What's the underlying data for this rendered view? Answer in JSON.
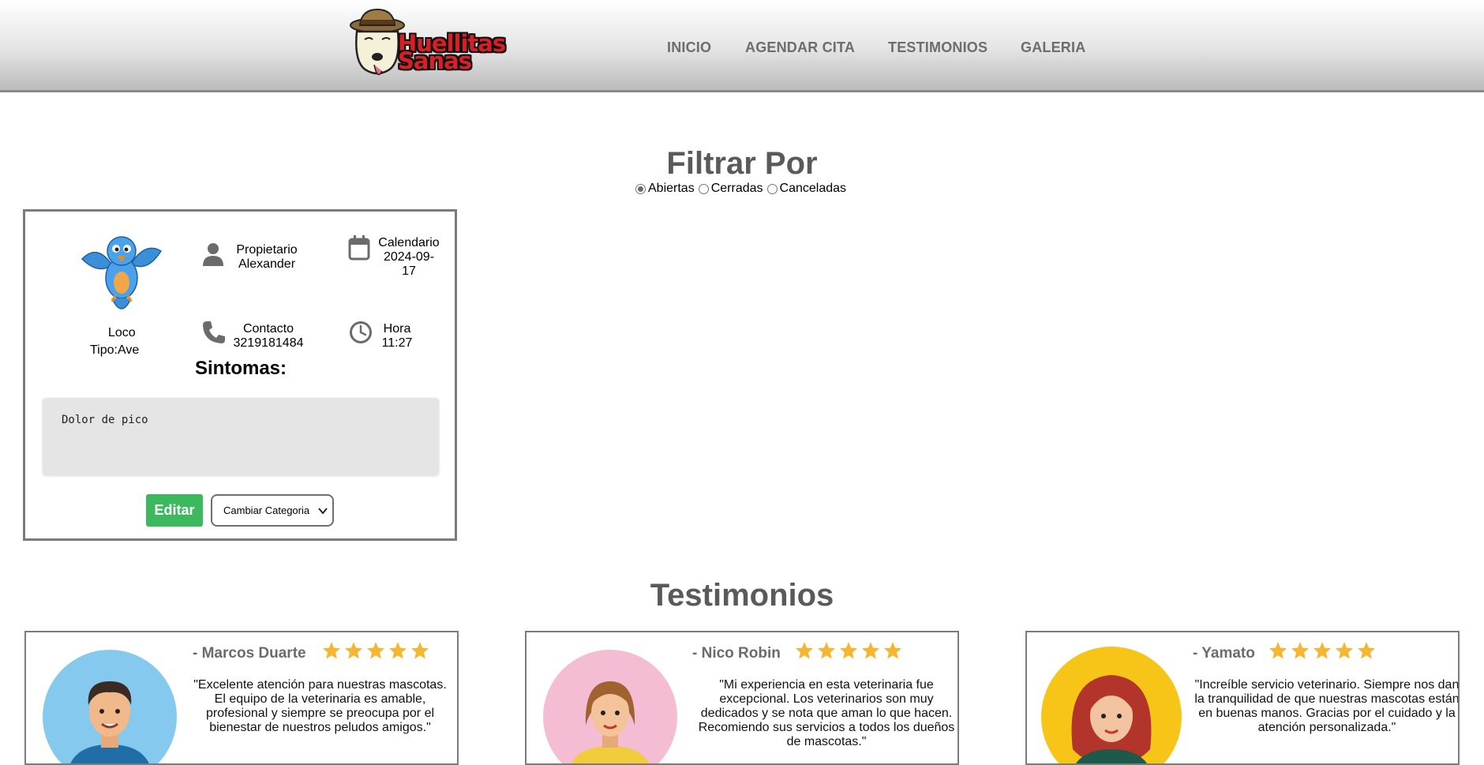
{
  "brand": {
    "logo_line1": "Huellitas",
    "logo_line2": "Sanas"
  },
  "nav": {
    "items": [
      "INICIO",
      "AGENDAR CITA",
      "TESTIMONIOS",
      "GALERIA"
    ]
  },
  "filter": {
    "title": "Filtrar Por",
    "options": [
      "Abiertas",
      "Cerradas",
      "Canceladas"
    ],
    "selected": "Abiertas"
  },
  "appointment": {
    "pet_name": "Loco",
    "pet_type": "Tipo:Ave",
    "owner_label": "Propietario",
    "owner": "Alexander",
    "calendar_label": "Calendario",
    "date_line1": "2024-09-",
    "date_line2": "17",
    "contact_label": "Contacto",
    "contact": "3219181484",
    "time_label": "Hora",
    "time": "11:27",
    "symptoms_title": "Sintomas:",
    "symptoms": "Dolor de pico",
    "edit_label": "Editar",
    "category_select": "Cambiar Categoria"
  },
  "testimonials": {
    "title": "Testimonios",
    "items": [
      {
        "name": "- Marcos Duarte",
        "stars": 5,
        "quote": "\"Excelente atención para nuestras mascotas. El equipo de la veterinaria es amable, profesional y siempre se preocupa por el bienestar de nuestros peludos amigos.\""
      },
      {
        "name": "- Nico Robin",
        "stars": 5,
        "quote": "\"Mi experiencia en esta veterinaria fue excepcional. Los veterinarios son muy dedicados y se nota que aman lo que hacen. Recomiendo sus servicios a todos los dueños de mascotas.\""
      },
      {
        "name": "- Yamato",
        "stars": 5,
        "quote": "\"Increíble servicio veterinario. Siempre nos dan la tranquilidad de que nuestras mascotas están en buenas manos. Gracias por el cuidado y la atención personalizada.\""
      }
    ]
  },
  "colors": {
    "accent_green": "#3cb95f",
    "brand_red": "#d61f26",
    "star": "#f5b731",
    "heading_gray": "#5a5a5a"
  }
}
